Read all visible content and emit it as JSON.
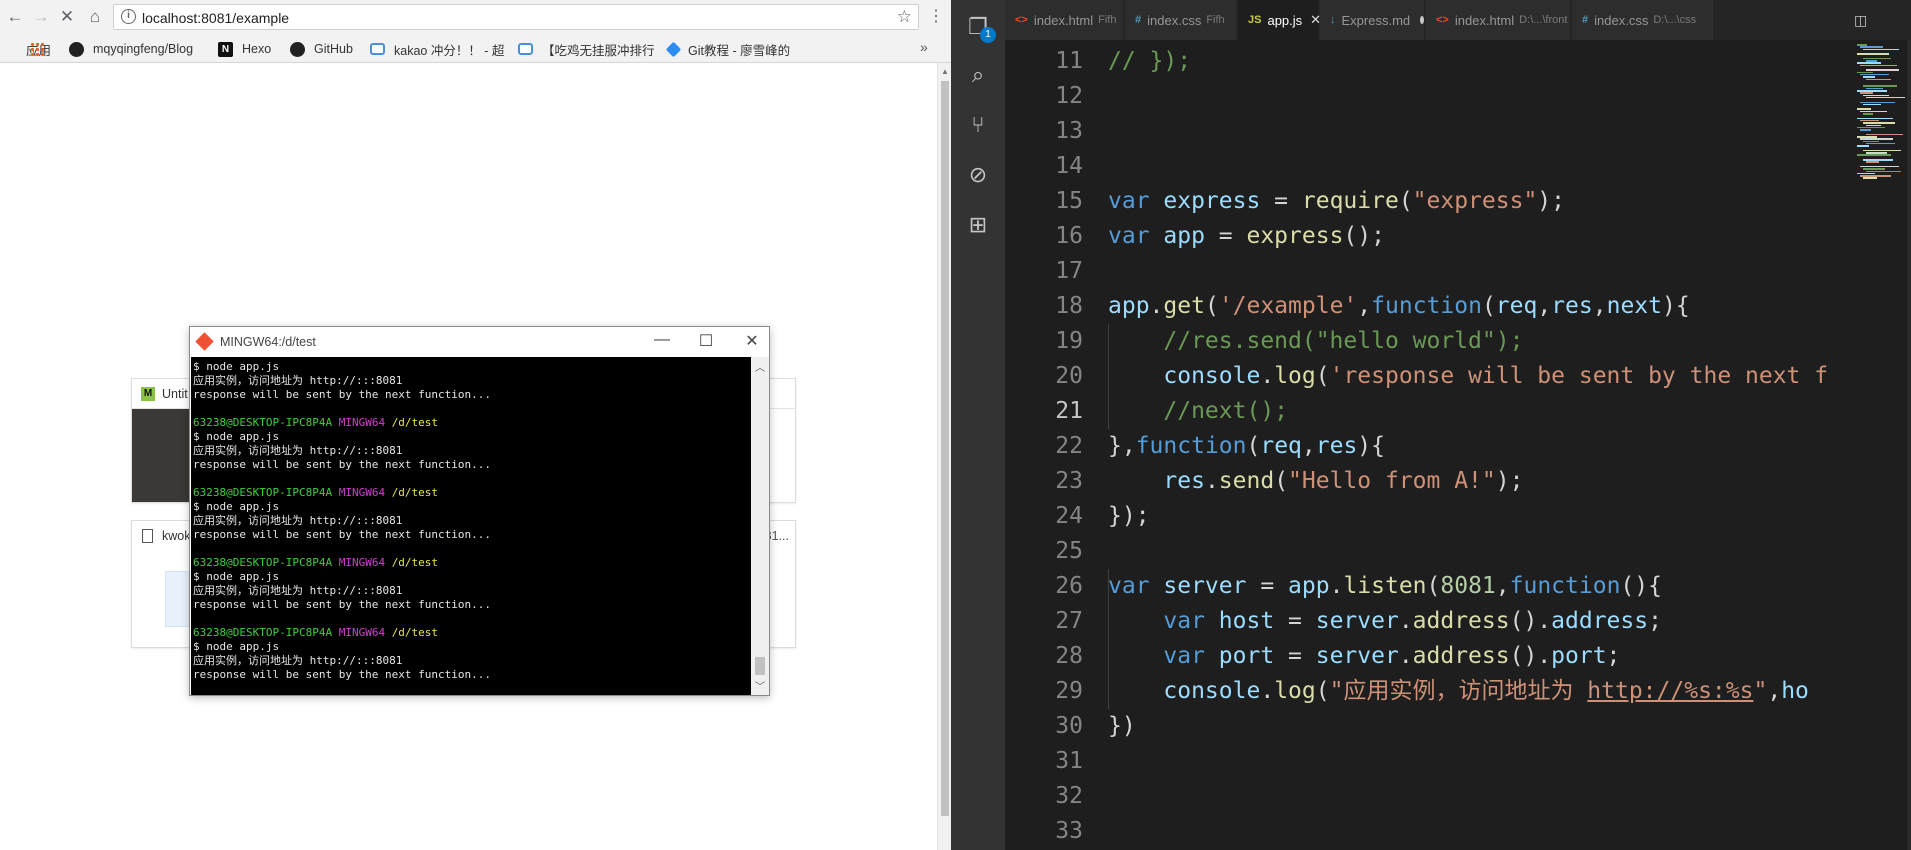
{
  "browser": {
    "url": "localhost:8081/example",
    "bookmarks": [
      {
        "icon": "apps-icon",
        "label": "应用"
      },
      {
        "icon": "github-icon",
        "label": "mqyqingfeng/Blog"
      },
      {
        "icon": "hexo-icon",
        "label": "Hexo"
      },
      {
        "icon": "github-icon",
        "label": "GitHub"
      },
      {
        "icon": "bilibili-icon",
        "label": "kakao 冲分！！ - 超"
      },
      {
        "icon": "bilibili-icon",
        "label": "【吃鸡无挂服冲排行"
      },
      {
        "icon": "rocket-icon",
        "label": "Git教程 - 廖雪峰的"
      }
    ],
    "cards": [
      {
        "title": "Untit"
      },
      {
        "title": "kwok",
        "right": "81..."
      }
    ]
  },
  "terminal": {
    "title": "MINGW64:/d/test",
    "lines": [
      {
        "type": "plain",
        "text": "$ node app.js"
      },
      {
        "type": "plain",
        "text": "应用实例，访问地址为 http://:::8081"
      },
      {
        "type": "plain",
        "text": "response will be sent by the next function..."
      },
      {
        "type": "plain",
        "text": ""
      },
      {
        "type": "prompt",
        "user": "63238@DESKTOP-IPC8P4A",
        "shell": "MINGW64",
        "path": "/d/test"
      },
      {
        "type": "plain",
        "text": "$ node app.js"
      },
      {
        "type": "plain",
        "text": "应用实例，访问地址为 http://:::8081"
      },
      {
        "type": "plain",
        "text": "response will be sent by the next function..."
      },
      {
        "type": "plain",
        "text": ""
      },
      {
        "type": "prompt",
        "user": "63238@DESKTOP-IPC8P4A",
        "shell": "MINGW64",
        "path": "/d/test"
      },
      {
        "type": "plain",
        "text": "$ node app.js"
      },
      {
        "type": "plain",
        "text": "应用实例，访问地址为 http://:::8081"
      },
      {
        "type": "plain",
        "text": "response will be sent by the next function..."
      },
      {
        "type": "plain",
        "text": ""
      },
      {
        "type": "prompt",
        "user": "63238@DESKTOP-IPC8P4A",
        "shell": "MINGW64",
        "path": "/d/test"
      },
      {
        "type": "plain",
        "text": "$ node app.js"
      },
      {
        "type": "plain",
        "text": "应用实例，访问地址为 http://:::8081"
      },
      {
        "type": "plain",
        "text": "response will be sent by the next function..."
      },
      {
        "type": "plain",
        "text": ""
      },
      {
        "type": "prompt",
        "user": "63238@DESKTOP-IPC8P4A",
        "shell": "MINGW64",
        "path": "/d/test"
      },
      {
        "type": "plain",
        "text": "$ node app.js"
      },
      {
        "type": "plain",
        "text": "应用实例，访问地址为 http://:::8081"
      },
      {
        "type": "plain",
        "text": "response will be sent by the next function..."
      }
    ]
  },
  "vscode": {
    "scm_badge": "1",
    "tabs": [
      {
        "icon": "<>",
        "label": "index.html",
        "desc": "Fifh"
      },
      {
        "icon": "#",
        "label": "index.css",
        "desc": "Fifh"
      },
      {
        "icon": "JS",
        "label": "app.js",
        "desc": "",
        "active": true
      },
      {
        "icon": "↓",
        "label": "Express.md",
        "desc": "",
        "dirty": true
      },
      {
        "icon": "<>",
        "label": "index.html",
        "desc": "D:\\...\\front"
      },
      {
        "icon": "#",
        "label": "index.css",
        "desc": "D:\\...\\css"
      }
    ],
    "current_line": 21,
    "code": [
      {
        "n": 11,
        "t": [
          [
            "c",
            "// });"
          ]
        ]
      },
      {
        "n": 12,
        "t": []
      },
      {
        "n": 13,
        "t": []
      },
      {
        "n": 14,
        "t": []
      },
      {
        "n": 15,
        "t": [
          [
            "k",
            "var "
          ],
          [
            "v",
            "express"
          ],
          [
            "p",
            " = "
          ],
          [
            "f",
            "require"
          ],
          [
            "p",
            "("
          ],
          [
            "s",
            "\"express\""
          ],
          [
            "p",
            ");"
          ]
        ]
      },
      {
        "n": 16,
        "t": [
          [
            "k",
            "var "
          ],
          [
            "v",
            "app"
          ],
          [
            "p",
            " = "
          ],
          [
            "f",
            "express"
          ],
          [
            "p",
            "();"
          ]
        ]
      },
      {
        "n": 17,
        "t": []
      },
      {
        "n": 18,
        "t": [
          [
            "v",
            "app"
          ],
          [
            "p",
            "."
          ],
          [
            "f",
            "get"
          ],
          [
            "p",
            "("
          ],
          [
            "s",
            "'/example'"
          ],
          [
            "p",
            ","
          ],
          [
            "k",
            "function"
          ],
          [
            "p",
            "("
          ],
          [
            "v",
            "req"
          ],
          [
            "p",
            ","
          ],
          [
            "v",
            "res"
          ],
          [
            "p",
            ","
          ],
          [
            "v",
            "next"
          ],
          [
            "p",
            "){"
          ]
        ]
      },
      {
        "n": 19,
        "t": [
          [
            "p",
            "    "
          ],
          [
            "c",
            "//res.send(\"hello world\");"
          ]
        ]
      },
      {
        "n": 20,
        "t": [
          [
            "p",
            "    "
          ],
          [
            "v",
            "console"
          ],
          [
            "p",
            "."
          ],
          [
            "f",
            "log"
          ],
          [
            "p",
            "("
          ],
          [
            "s",
            "'response will be sent by the next f"
          ]
        ]
      },
      {
        "n": 21,
        "t": [
          [
            "p",
            "    "
          ],
          [
            "c",
            "//next();"
          ]
        ]
      },
      {
        "n": 22,
        "t": [
          [
            "p",
            "},"
          ],
          [
            "k",
            "function"
          ],
          [
            "p",
            "("
          ],
          [
            "v",
            "req"
          ],
          [
            "p",
            ","
          ],
          [
            "v",
            "res"
          ],
          [
            "p",
            "){"
          ]
        ]
      },
      {
        "n": 23,
        "t": [
          [
            "p",
            "    "
          ],
          [
            "v",
            "res"
          ],
          [
            "p",
            "."
          ],
          [
            "f",
            "send"
          ],
          [
            "p",
            "("
          ],
          [
            "s",
            "\"Hello from A!\""
          ],
          [
            "p",
            ");"
          ]
        ]
      },
      {
        "n": 24,
        "t": [
          [
            "p",
            "});"
          ]
        ]
      },
      {
        "n": 25,
        "t": []
      },
      {
        "n": 26,
        "t": [
          [
            "k",
            "var "
          ],
          [
            "v",
            "server"
          ],
          [
            "p",
            " = "
          ],
          [
            "v",
            "app"
          ],
          [
            "p",
            "."
          ],
          [
            "f",
            "listen"
          ],
          [
            "p",
            "("
          ],
          [
            "n",
            "8081"
          ],
          [
            "p",
            ","
          ],
          [
            "k",
            "function"
          ],
          [
            "p",
            "(){"
          ]
        ]
      },
      {
        "n": 27,
        "t": [
          [
            "p",
            "    "
          ],
          [
            "k",
            "var "
          ],
          [
            "v",
            "host"
          ],
          [
            "p",
            " = "
          ],
          [
            "v",
            "server"
          ],
          [
            "p",
            "."
          ],
          [
            "f",
            "address"
          ],
          [
            "p",
            "()."
          ],
          [
            "v",
            "address"
          ],
          [
            "p",
            ";"
          ]
        ]
      },
      {
        "n": 28,
        "t": [
          [
            "p",
            "    "
          ],
          [
            "k",
            "var "
          ],
          [
            "v",
            "port"
          ],
          [
            "p",
            " = "
          ],
          [
            "v",
            "server"
          ],
          [
            "p",
            "."
          ],
          [
            "f",
            "address"
          ],
          [
            "p",
            "()."
          ],
          [
            "v",
            "port"
          ],
          [
            "p",
            ";"
          ]
        ]
      },
      {
        "n": 29,
        "t": [
          [
            "p",
            "    "
          ],
          [
            "v",
            "console"
          ],
          [
            "p",
            "."
          ],
          [
            "f",
            "log"
          ],
          [
            "p",
            "("
          ],
          [
            "s",
            "\"应用实例，访问地址为 "
          ],
          [
            "su",
            "http://%s:%s"
          ],
          [
            "s",
            "\""
          ],
          [
            "p",
            ","
          ],
          [
            "v",
            "ho"
          ]
        ]
      },
      {
        "n": 30,
        "t": [
          [
            "p",
            "})"
          ]
        ]
      },
      {
        "n": 31,
        "t": []
      },
      {
        "n": 32,
        "t": []
      },
      {
        "n": 33,
        "t": []
      }
    ]
  }
}
